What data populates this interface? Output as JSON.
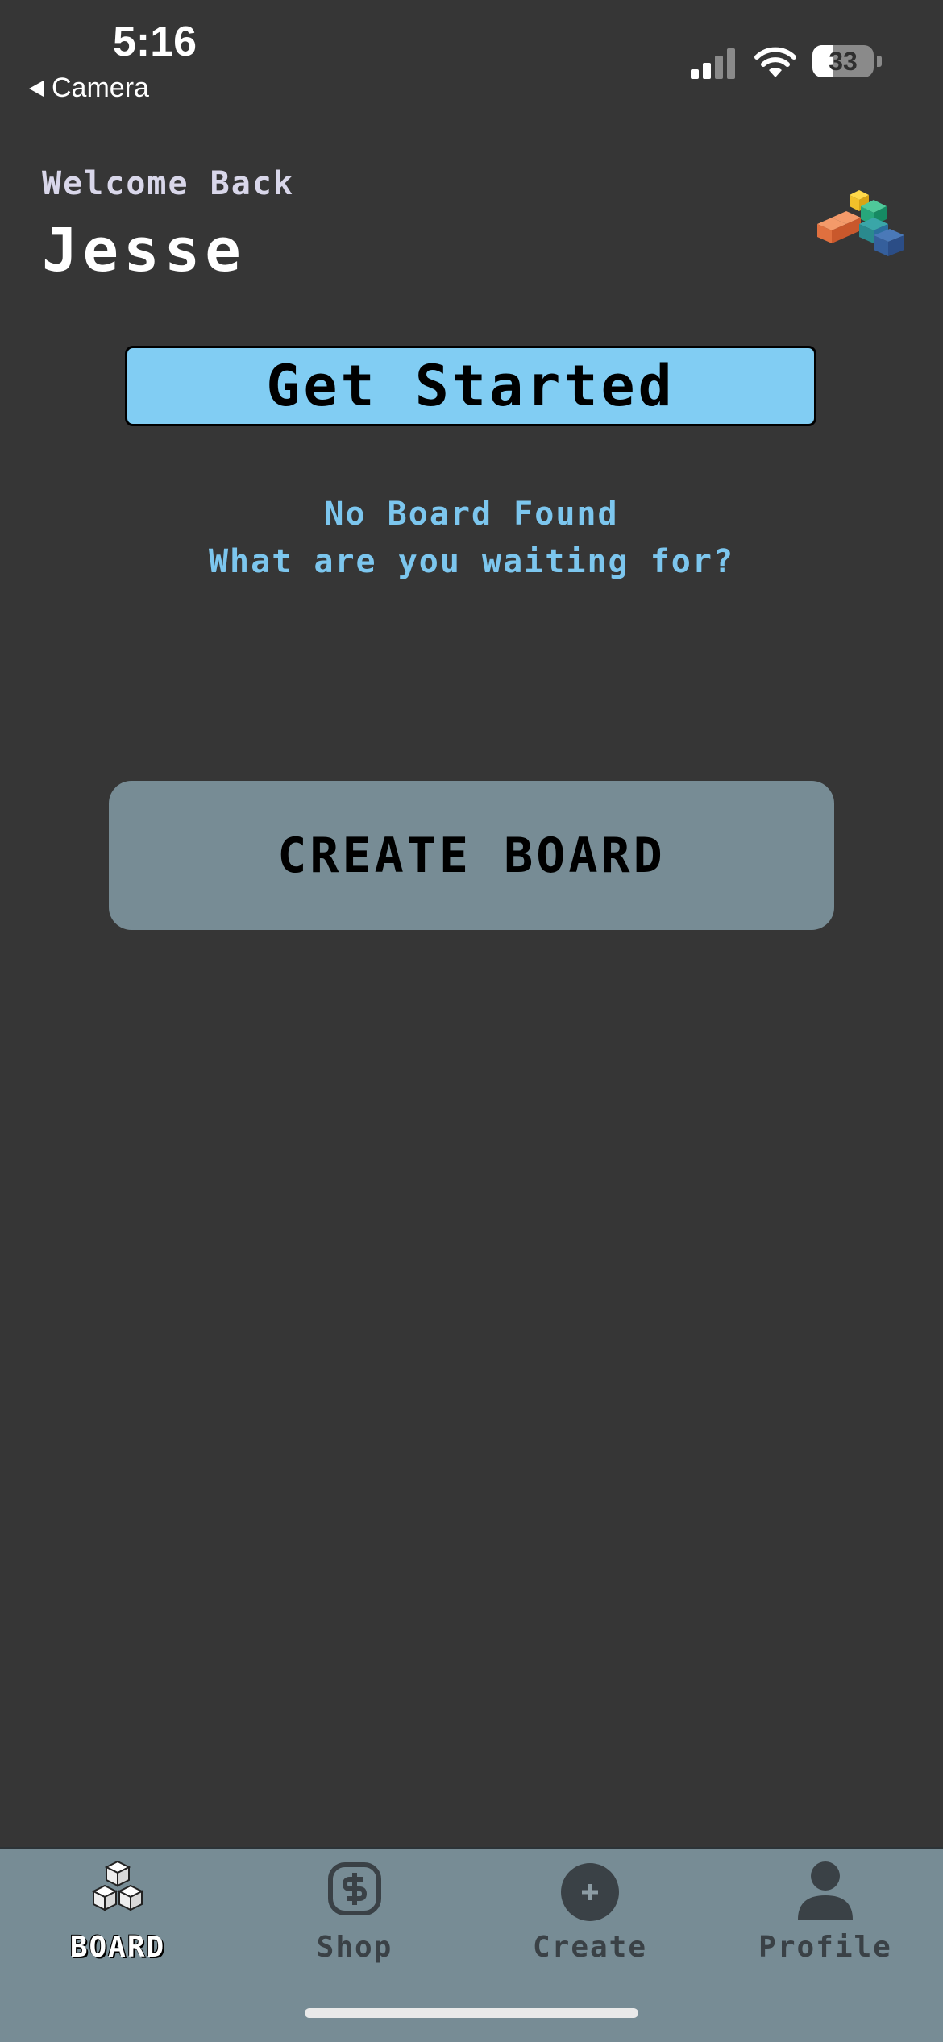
{
  "status_bar": {
    "time": "5:16",
    "back_label": "Camera",
    "battery_percent": "33",
    "battery_level": 0.33
  },
  "header": {
    "welcome": "Welcome Back",
    "username": "Jesse",
    "logo_icon": "cube-stack-logo-icon"
  },
  "main": {
    "get_started_label": "Get Started",
    "empty_title": "No Board Found",
    "empty_subtitle": "What are you waiting for?",
    "create_board_label": "CREATE BOARD"
  },
  "tabbar": {
    "tabs": [
      {
        "label": "BOARD",
        "icon": "cubes-icon",
        "active": true
      },
      {
        "label": "Shop",
        "icon": "dollar-icon",
        "active": false
      },
      {
        "label": "Create",
        "icon": "plus-circle-icon",
        "active": false
      },
      {
        "label": "Profile",
        "icon": "person-icon",
        "active": false
      }
    ]
  },
  "colors": {
    "background": "#363636",
    "accent_blue": "#81cdf3",
    "message_blue": "#7cc6ee",
    "slate": "#778c95"
  }
}
